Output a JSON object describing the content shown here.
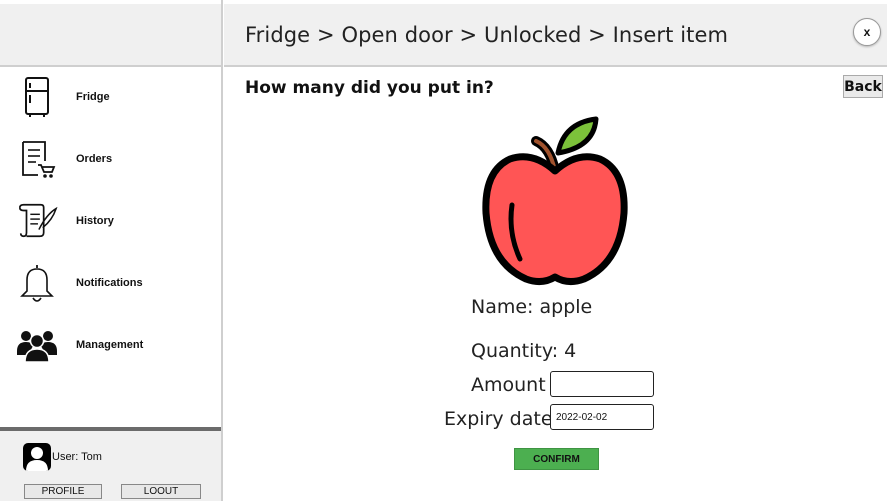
{
  "header": {
    "breadcrumb": "Fridge > Open door > Unlocked > Insert item",
    "close_label": "x"
  },
  "sidebar": {
    "items": [
      {
        "label": "Fridge",
        "icon": "fridge-icon"
      },
      {
        "label": "Orders",
        "icon": "orders-icon"
      },
      {
        "label": "History",
        "icon": "history-icon"
      },
      {
        "label": "Notifications",
        "icon": "bell-icon"
      },
      {
        "label": "Management",
        "icon": "users-icon"
      }
    ],
    "user": {
      "name": "User: Tom",
      "profile_label": "PROFILE",
      "logout_label": "LOOUT"
    }
  },
  "main": {
    "question": "How many did you put in?",
    "back_label": "Back",
    "item_image": "apple-icon",
    "name_text": "Name: apple",
    "quantity_text": "Quantity: 4",
    "amount_label": "Amount",
    "amount_value": "",
    "expiry_label": "Expiry date",
    "expiry_value": "2022-02-02",
    "confirm_label": "CONFIRM"
  },
  "colors": {
    "panel_bg": "#f0f0f0",
    "confirm_green": "#4caf50",
    "apple_red": "#ff5555",
    "leaf_green": "#7cc23a"
  }
}
